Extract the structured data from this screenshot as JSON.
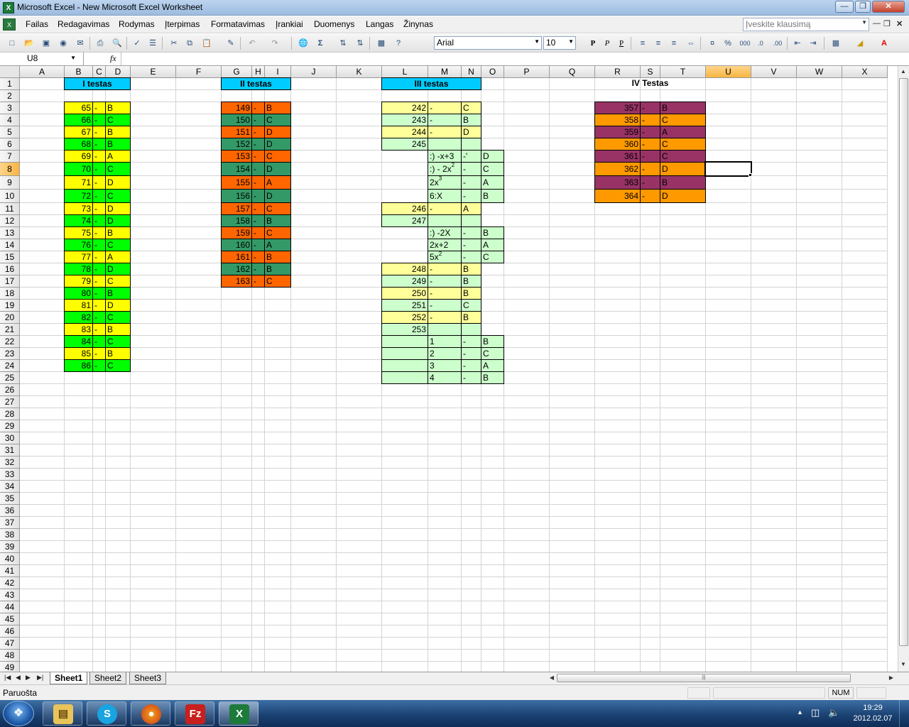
{
  "window": {
    "title": "Microsoft Excel - New Microsoft Excel Worksheet"
  },
  "menu": [
    "Failas",
    "Redagavimas",
    "Rodymas",
    "Įterpimas",
    "Formatavimas",
    "Įrankiai",
    "Duomenys",
    "Langas",
    "Žinynas"
  ],
  "help_placeholder": "Įveskite klausimą",
  "font": {
    "name": "Arial",
    "size": "10"
  },
  "name_box": "U8",
  "fx_label": "fx",
  "columns": [
    "A",
    "B",
    "C",
    "D",
    "E",
    "F",
    "G",
    "H",
    "I",
    "J",
    "K",
    "L",
    "M",
    "N",
    "O",
    "P",
    "Q",
    "R",
    "S",
    "T",
    "U",
    "V",
    "W",
    "X"
  ],
  "selected": {
    "column": "U",
    "row": 8
  },
  "rows": [
    1,
    2,
    3,
    4,
    5,
    6,
    7,
    8,
    9,
    10,
    11,
    12,
    13,
    14,
    15,
    16,
    17,
    18,
    19,
    20,
    21,
    22,
    23,
    24,
    25,
    26,
    27,
    28,
    29,
    30,
    31,
    32,
    33,
    34,
    35,
    36,
    37,
    38,
    39,
    40,
    41,
    42,
    43,
    44,
    45,
    46,
    47,
    48,
    49
  ],
  "colors": {
    "yellow": "#ffff00",
    "green": "#00ff00",
    "orange": "#ff6600",
    "seagreen": "#339966",
    "lightgreen": "#ccffcc",
    "lightyellow": "#ffff99",
    "plum": "#993366",
    "lightorange": "#ff9900",
    "cyan": "#00ccff"
  },
  "headers": [
    {
      "text": "I testas",
      "cell": "B1:D1",
      "fill": "cyan"
    },
    {
      "text": "II testas",
      "cell": "G1:I1",
      "fill": "cyan"
    },
    {
      "text": "III testas",
      "cell": "L1:N1",
      "fill": "cyan"
    },
    {
      "text": "IV Testas",
      "cell": "R1:T1",
      "fill": "none"
    }
  ],
  "test1": [
    {
      "row": 3,
      "num": "65",
      "dash": "-",
      "ans": "B",
      "fill": "yellow"
    },
    {
      "row": 4,
      "num": "66",
      "dash": "-",
      "ans": "C",
      "fill": "green"
    },
    {
      "row": 5,
      "num": "67",
      "dash": "-",
      "ans": "B",
      "fill": "yellow"
    },
    {
      "row": 6,
      "num": "68",
      "dash": "-",
      "ans": "B",
      "fill": "green"
    },
    {
      "row": 7,
      "num": "69",
      "dash": "-",
      "ans": "A",
      "fill": "yellow"
    },
    {
      "row": 8,
      "num": "70",
      "dash": "-",
      "ans": "C",
      "fill": "green"
    },
    {
      "row": 9,
      "num": "71",
      "dash": "-",
      "ans": "D",
      "fill": "yellow"
    },
    {
      "row": 10,
      "num": "72",
      "dash": "-",
      "ans": "C",
      "fill": "green"
    },
    {
      "row": 11,
      "num": "73",
      "dash": "-",
      "ans": "D",
      "fill": "yellow"
    },
    {
      "row": 12,
      "num": "74",
      "dash": "-",
      "ans": "D",
      "fill": "green"
    },
    {
      "row": 13,
      "num": "75",
      "dash": "-",
      "ans": "B",
      "fill": "yellow"
    },
    {
      "row": 14,
      "num": "76",
      "dash": "-",
      "ans": "C",
      "fill": "green"
    },
    {
      "row": 15,
      "num": "77",
      "dash": "-",
      "ans": "A",
      "fill": "yellow"
    },
    {
      "row": 16,
      "num": "78",
      "dash": "-",
      "ans": "D",
      "fill": "green"
    },
    {
      "row": 17,
      "num": "79",
      "dash": "-",
      "ans": "C",
      "fill": "yellow"
    },
    {
      "row": 18,
      "num": "80",
      "dash": "-",
      "ans": "B",
      "fill": "green"
    },
    {
      "row": 19,
      "num": "81",
      "dash": "-",
      "ans": "D",
      "fill": "yellow"
    },
    {
      "row": 20,
      "num": "82",
      "dash": "-",
      "ans": "C",
      "fill": "green"
    },
    {
      "row": 21,
      "num": "83",
      "dash": "-",
      "ans": "B",
      "fill": "yellow"
    },
    {
      "row": 22,
      "num": "84",
      "dash": "-",
      "ans": "C",
      "fill": "green"
    },
    {
      "row": 23,
      "num": "85",
      "dash": "-",
      "ans": "B",
      "fill": "yellow"
    },
    {
      "row": 24,
      "num": "86",
      "dash": "-",
      "ans": "C",
      "fill": "green"
    }
  ],
  "test2": [
    {
      "row": 3,
      "num": "149",
      "dash": "-",
      "ans": "B",
      "fill": "orange"
    },
    {
      "row": 4,
      "num": "150",
      "dash": "-",
      "ans": "C",
      "fill": "seagreen"
    },
    {
      "row": 5,
      "num": "151",
      "dash": "-",
      "ans": "D",
      "fill": "orange"
    },
    {
      "row": 6,
      "num": "152",
      "dash": "-",
      "ans": "D",
      "fill": "seagreen"
    },
    {
      "row": 7,
      "num": "153",
      "dash": "-",
      "ans": "C",
      "fill": "orange"
    },
    {
      "row": 8,
      "num": "154",
      "dash": "-",
      "ans": "D",
      "fill": "seagreen"
    },
    {
      "row": 9,
      "num": "155",
      "dash": "-",
      "ans": "A",
      "fill": "orange"
    },
    {
      "row": 10,
      "num": "156",
      "dash": "-",
      "ans": "D",
      "fill": "seagreen"
    },
    {
      "row": 11,
      "num": "157",
      "dash": "-",
      "ans": "C",
      "fill": "orange"
    },
    {
      "row": 12,
      "num": "158",
      "dash": "-",
      "ans": "B",
      "fill": "seagreen"
    },
    {
      "row": 13,
      "num": "159",
      "dash": "-",
      "ans": "C",
      "fill": "orange"
    },
    {
      "row": 14,
      "num": "160",
      "dash": "-",
      "ans": "A",
      "fill": "seagreen"
    },
    {
      "row": 15,
      "num": "161",
      "dash": "-",
      "ans": "B",
      "fill": "orange"
    },
    {
      "row": 16,
      "num": "162",
      "dash": "-",
      "ans": "B",
      "fill": "seagreen"
    },
    {
      "row": 17,
      "num": "163",
      "dash": "-",
      "ans": "C",
      "fill": "orange"
    }
  ],
  "test3_main": [
    {
      "row": 3,
      "num": "242",
      "dash": "-",
      "ans": "C",
      "fill": "lightyellow"
    },
    {
      "row": 4,
      "num": "243",
      "dash": "-",
      "ans": "B",
      "fill": "lightgreen"
    },
    {
      "row": 5,
      "num": "244",
      "dash": "-",
      "ans": "D",
      "fill": "lightyellow"
    },
    {
      "row": 6,
      "num": "245",
      "dash": "",
      "ans": "",
      "fill": "lightgreen"
    },
    {
      "row": 11,
      "num": "246",
      "dash": "-",
      "ans": "A",
      "fill": "lightyellow"
    },
    {
      "row": 12,
      "num": "247",
      "dash": "",
      "ans": "",
      "fill": "lightgreen"
    },
    {
      "row": 16,
      "num": "248",
      "dash": "-",
      "ans": "B",
      "fill": "lightyellow"
    },
    {
      "row": 17,
      "num": "249",
      "dash": "-",
      "ans": "B",
      "fill": "lightgreen"
    },
    {
      "row": 18,
      "num": "250",
      "dash": "-",
      "ans": "B",
      "fill": "lightyellow"
    },
    {
      "row": 19,
      "num": "251",
      "dash": "-",
      "ans": "C",
      "fill": "lightgreen"
    },
    {
      "row": 20,
      "num": "252",
      "dash": "-",
      "ans": "B",
      "fill": "lightyellow"
    },
    {
      "row": 21,
      "num": "253",
      "dash": "",
      "ans": "",
      "fill": "lightgreen"
    }
  ],
  "test3_sub": [
    {
      "row": 7,
      "text": ":) -x+3",
      "sup": "",
      "dash": "-'",
      "ans": "D"
    },
    {
      "row": 8,
      "text": ":) - 2x",
      "sup": "2",
      "dash": "-",
      "ans": "C"
    },
    {
      "row": 9,
      "text": "2x",
      "sup": "3",
      "dash": "-",
      "ans": "A"
    },
    {
      "row": 10,
      "text": "6:X",
      "sup": "",
      "dash": "-",
      "ans": "B"
    },
    {
      "row": 13,
      "text": ":) -2X",
      "sup": "",
      "dash": "-",
      "ans": "B"
    },
    {
      "row": 14,
      "text": "2x+2",
      "sup": "",
      "dash": "-",
      "ans": "A"
    },
    {
      "row": 15,
      "text": "5x",
      "sup": "2",
      "dash": "-",
      "ans": "C"
    }
  ],
  "test3_tail": [
    {
      "row": 22,
      "text": "1",
      "dash": "-",
      "ans": "B"
    },
    {
      "row": 23,
      "text": "2",
      "dash": "-",
      "ans": "C"
    },
    {
      "row": 24,
      "text": "3",
      "dash": "-",
      "ans": "A"
    },
    {
      "row": 25,
      "text": "4",
      "dash": "-",
      "ans": "B"
    }
  ],
  "test4": [
    {
      "row": 3,
      "num": "357",
      "dash": "-",
      "ans": "B",
      "fill": "plum"
    },
    {
      "row": 4,
      "num": "358",
      "dash": "-",
      "ans": "C",
      "fill": "lightorange"
    },
    {
      "row": 5,
      "num": "359",
      "dash": "-",
      "ans": "A",
      "fill": "plum"
    },
    {
      "row": 6,
      "num": "360",
      "dash": "-",
      "ans": "C",
      "fill": "lightorange"
    },
    {
      "row": 7,
      "num": "361",
      "dash": "-",
      "ans": "C",
      "fill": "plum"
    },
    {
      "row": 8,
      "num": "362",
      "dash": "-",
      "ans": "D",
      "fill": "lightorange"
    },
    {
      "row": 9,
      "num": "363",
      "dash": "-",
      "ans": "B",
      "fill": "plum"
    },
    {
      "row": 10,
      "num": "364",
      "dash": "-",
      "ans": "D",
      "fill": "lightorange"
    }
  ],
  "sheets": [
    "Sheet1",
    "Sheet2",
    "Sheet3"
  ],
  "active_sheet": "Sheet1",
  "status": {
    "text": "Paruošta",
    "num": "NUM"
  },
  "taskbar": {
    "apps": [
      "explorer",
      "skype",
      "firefox",
      "filezilla",
      "excel"
    ],
    "time": "19:29",
    "date": "2012.02.07"
  }
}
